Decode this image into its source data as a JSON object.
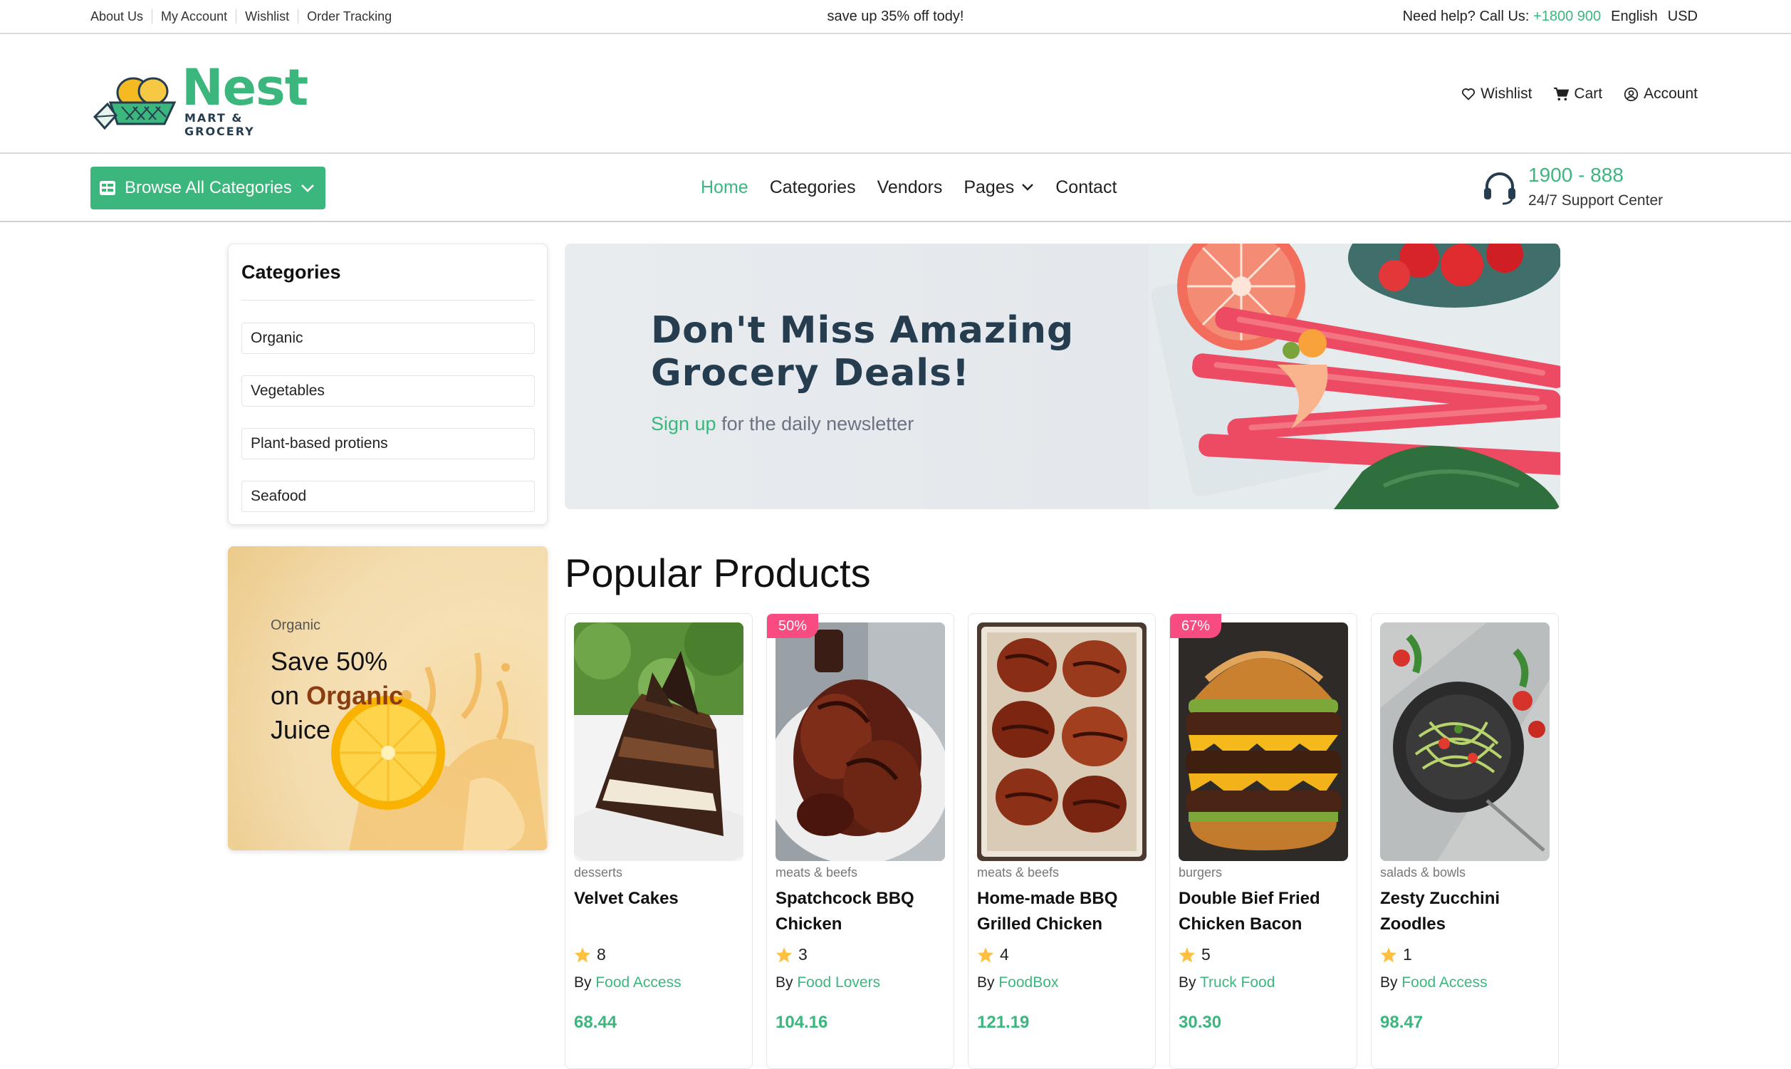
{
  "topbar": {
    "links": [
      "About Us",
      "My Account",
      "Wishlist",
      "Order Tracking"
    ],
    "promo": "save up 35% off tody!",
    "help_label": "Need help? Call Us:",
    "help_phone": "+1800 900",
    "language": "English",
    "currency": "USD"
  },
  "logo": {
    "name": "Nest",
    "tagline": "MART & GROCERY"
  },
  "header_actions": {
    "wishlist": "Wishlist",
    "cart": "Cart",
    "account": "Account"
  },
  "nav": {
    "browse": "Browse All Categories",
    "items": [
      "Home",
      "Categories",
      "Vendors",
      "Pages",
      "Contact"
    ],
    "support_number": "1900 - 888",
    "support_label": "24/7 Support Center"
  },
  "sidebar": {
    "title": "Categories",
    "categories": [
      "Organic",
      "Vegetables",
      "Plant-based protiens",
      "Seafood"
    ]
  },
  "promo_card": {
    "tag": "Organic",
    "line1": "Save 50%",
    "line2_prefix": "on",
    "line2_highlight": "Organic",
    "line3": "Juice"
  },
  "hero": {
    "title": "Don't Miss Amazing Grocery Deals!",
    "cta": "Sign up",
    "subtitle": "for the daily newsletter"
  },
  "popular": {
    "title": "Popular Products",
    "by_label": "By",
    "products": [
      {
        "badge": "",
        "category": "desserts",
        "name": "Velvet Cakes",
        "rating": "8",
        "vendor": "Food Access",
        "price": "68.44"
      },
      {
        "badge": "50%",
        "category": "meats & beefs",
        "name": "Spatchcock BBQ Chicken",
        "rating": "3",
        "vendor": "Food Lovers",
        "price": "104.16"
      },
      {
        "badge": "",
        "category": "meats & beefs",
        "name": "Home-made BBQ Grilled Chicken",
        "rating": "4",
        "vendor": "FoodBox",
        "price": "121.19"
      },
      {
        "badge": "67%",
        "category": "burgers",
        "name": "Double Bief Fried Chicken Bacon",
        "rating": "5",
        "vendor": "Truck Food",
        "price": "30.30"
      },
      {
        "badge": "",
        "category": "salads & bowls",
        "name": "Zesty Zucchini Zoodles",
        "rating": "1",
        "vendor": "Food Access",
        "price": "98.47"
      }
    ]
  },
  "colors": {
    "brand_green": "#3bb77e",
    "badge_pink": "#f74b81",
    "heading_navy": "#253d4e",
    "star_yellow": "#fdc040"
  }
}
